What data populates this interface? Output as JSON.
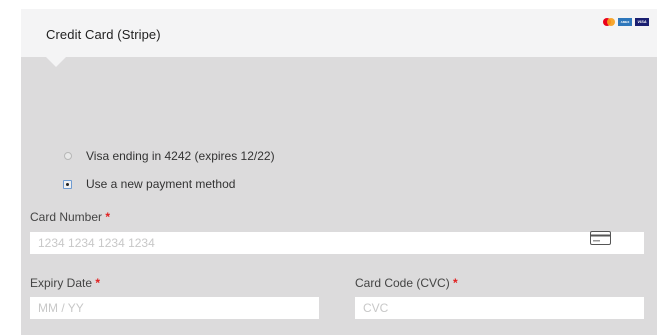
{
  "panel": {
    "title": "Credit Card (Stripe)"
  },
  "brand_logos": [
    {
      "name": "mastercard",
      "color1": "#eb001b",
      "color2": "#f79e1b"
    },
    {
      "name": "amex",
      "text": "AMEX",
      "color": "#2e77bb"
    },
    {
      "name": "visa",
      "text": "VISA",
      "color": "#1a1f71"
    }
  ],
  "payment_options": [
    {
      "label": "Visa ending in 4242 (expires 12/22)",
      "selected": false
    },
    {
      "label": "Use a new payment method",
      "selected": true
    }
  ],
  "card_number": {
    "label": "Card Number",
    "required_mark": "*",
    "placeholder": "1234 1234 1234 1234",
    "value": ""
  },
  "expiry": {
    "label": "Expiry Date",
    "required_mark": "*",
    "placeholder": "MM / YY",
    "value": ""
  },
  "cvc": {
    "label": "Card Code (CVC)",
    "required_mark": "*",
    "placeholder": "CVC",
    "value": ""
  },
  "colors": {
    "panel_bg": "#dcdbdc",
    "header_bg": "#f4f4f5",
    "required": "#e02020",
    "input_bg": "#ffffff"
  }
}
